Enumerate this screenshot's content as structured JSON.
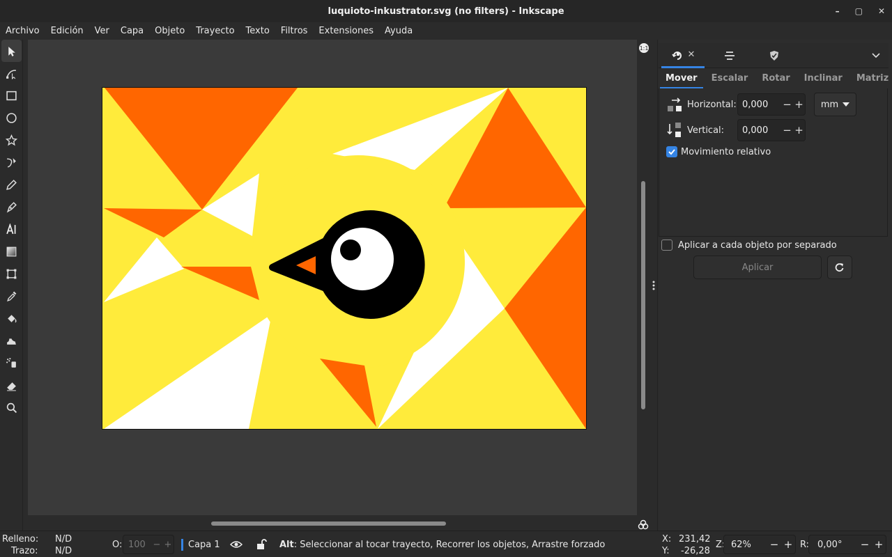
{
  "window": {
    "title": "luquioto-inkustrator.svg (no filters) - Inkscape",
    "controls": [
      "–",
      "▢",
      "✕"
    ]
  },
  "menu": [
    "Archivo",
    "Edición",
    "Ver",
    "Capa",
    "Objeto",
    "Trayecto",
    "Texto",
    "Filtros",
    "Extensiones",
    "Ayuda"
  ],
  "tools": [
    {
      "name": "selector-tool",
      "icon": "arrow-pointer-icon"
    },
    {
      "name": "node-tool",
      "icon": "node-edit-icon"
    },
    {
      "name": "rect-tool",
      "icon": "rectangle-icon"
    },
    {
      "name": "ellipse-tool",
      "icon": "circle-icon"
    },
    {
      "name": "star-tool",
      "icon": "star-polygon-icon"
    },
    {
      "name": "spiro-tool",
      "icon": "bezier-icon"
    },
    {
      "name": "pencil-tool",
      "icon": "pencil-icon"
    },
    {
      "name": "calligraphy-tool",
      "icon": "pen-nib-icon"
    },
    {
      "name": "text-tool",
      "icon": "text-icon"
    },
    {
      "name": "gradient-tool",
      "icon": "gradient-icon"
    },
    {
      "name": "mesh-tool",
      "icon": "mesh-icon"
    },
    {
      "name": "dropper-tool",
      "icon": "dropper-icon"
    },
    {
      "name": "paint-bucket-tool",
      "icon": "bucket-icon"
    },
    {
      "name": "tweak-tool",
      "icon": "tweak-icon"
    },
    {
      "name": "spray-tool",
      "icon": "spray-icon"
    },
    {
      "name": "eraser-tool",
      "icon": "eraser-icon"
    },
    {
      "name": "zoom-tool",
      "icon": "magnifier-icon"
    }
  ],
  "canvas": {
    "colors": {
      "yellow": "#ffeb3b",
      "orange": "#ff6600",
      "white": "#ffffff",
      "black": "#000000"
    }
  },
  "panel": {
    "tabs": [
      "transform-icon",
      "align-icon",
      "shield-icon"
    ],
    "subtabs": [
      "Mover",
      "Escalar",
      "Rotar",
      "Inclinar",
      "Matriz"
    ],
    "active_subtab": "Mover",
    "horizontal_label": "Horizontal:",
    "horizontal_value": "0,000",
    "vertical_label": "Vertical:",
    "vertical_value": "0,000",
    "unit": "mm",
    "relative_label": "Movimiento relativo",
    "relative_checked": true,
    "each_label": "Aplicar a cada objeto por separado",
    "each_checked": false,
    "apply_label": "Aplicar",
    "minus": "−",
    "plus": "+"
  },
  "status": {
    "fill_label": "Relleno:",
    "fill_value": "N/D",
    "stroke_label": "Trazo:",
    "stroke_value": "N/D",
    "opacity_label": "O:",
    "opacity_value": "100",
    "layer": "Capa 1",
    "message_key": "Alt",
    "message": ": Seleccionar al tocar trayecto, Recorrer los objetos, Arrastre forzado",
    "x_label": "X:",
    "x_value": "231,42",
    "y_label": "Y:",
    "y_value": "-26,28",
    "zoom_label": "Z:",
    "zoom_value": "62%",
    "rotation_label": "R:",
    "rotation_value": "0,00°"
  }
}
